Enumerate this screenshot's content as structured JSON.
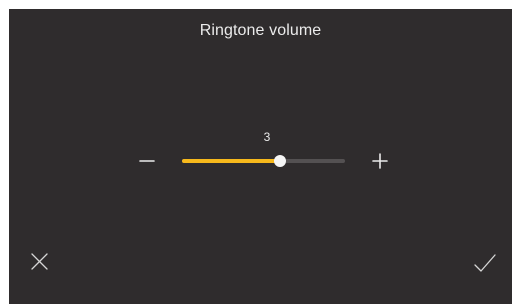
{
  "dialog": {
    "title": "Ringtone volume"
  },
  "volume": {
    "value": "3",
    "level_fraction": 0.6
  },
  "icons": {
    "decrease": "minus-icon",
    "increase": "plus-icon",
    "cancel": "close-icon",
    "confirm": "checkmark-icon"
  },
  "colors": {
    "background": "#2f2c2d",
    "accent": "#f7b91c",
    "track": "#545152",
    "thumb": "#f5f5f5",
    "text": "#ebebeb"
  }
}
